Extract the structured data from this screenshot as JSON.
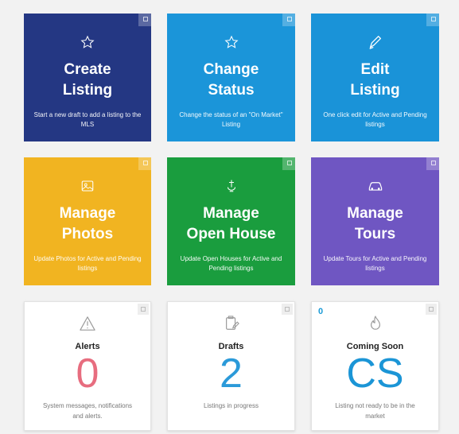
{
  "colors": {
    "navy": "#243783",
    "sky": "#1b95d9",
    "sky2": "#1a93d8",
    "yellow": "#f1b421",
    "green": "#1a9d3e",
    "purple": "#6f56c2",
    "alerts_number": "#e76d7f",
    "drafts_number": "#2b9ad9",
    "coming_soon_number": "#1b95d6"
  },
  "tiles": [
    {
      "icon": "star-icon",
      "title_line1": "Create",
      "title_line2": "Listing",
      "desc": "Start a new draft to add a listing to the MLS"
    },
    {
      "icon": "star-icon",
      "title_line1": "Change",
      "title_line2": "Status",
      "desc": "Change the status of an \"On Market\" Listing"
    },
    {
      "icon": "pencil-icon",
      "title_line1": "Edit",
      "title_line2": "Listing",
      "desc": "One click edit for Active and Pending listings"
    },
    {
      "icon": "photo-icon",
      "title_line1": "Manage",
      "title_line2": "Photos",
      "desc": "Update Photos for Active and Pending listings"
    },
    {
      "icon": "open-house-icon",
      "title_line1": "Manage",
      "title_line2": "Open House",
      "desc": "Update Open Houses for Active and Pending listings"
    },
    {
      "icon": "car-icon",
      "title_line1": "Manage",
      "title_line2": "Tours",
      "desc": "Update Tours for Active and Pending listings"
    }
  ],
  "cards": [
    {
      "icon": "warning-icon",
      "title": "Alerts",
      "number": "0",
      "desc": "System messages, notifications and alerts."
    },
    {
      "icon": "drafts-icon",
      "title": "Drafts",
      "number": "2",
      "desc": "Listings in progress"
    },
    {
      "icon": "flame-icon",
      "title": "Coming Soon",
      "number": "CS",
      "desc": "Listing not ready to be in the market",
      "badge": "0"
    }
  ]
}
